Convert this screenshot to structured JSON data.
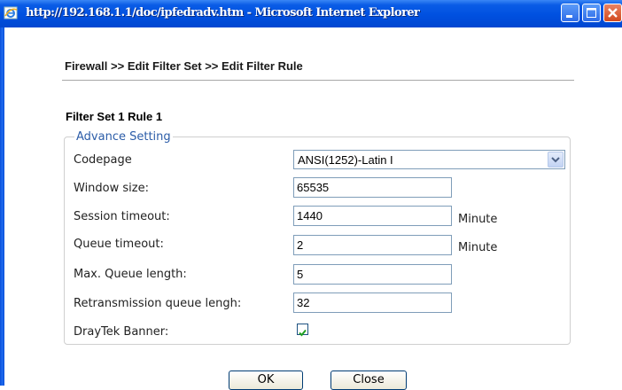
{
  "window": {
    "title": "http://192.168.1.1/doc/ipfedradv.htm - Microsoft Internet Explorer"
  },
  "page": {
    "breadcrumb": "Firewall >> Edit Filter Set >> Edit Filter Rule",
    "section_title": "Filter Set 1 Rule 1",
    "group_legend": "Advance Setting"
  },
  "form": {
    "codepage": {
      "label": "Codepage",
      "value": "ANSI(1252)-Latin I"
    },
    "window_size": {
      "label": "Window size:",
      "value": "65535"
    },
    "session_timeout": {
      "label": "Session timeout:",
      "value": "1440",
      "unit": "Minute"
    },
    "queue_timeout": {
      "label": "Queue timeout:",
      "value": "2",
      "unit": "Minute"
    },
    "max_queue_length": {
      "label": "Max. Queue length:",
      "value": "5"
    },
    "retransmission_queue_length": {
      "label": "Retransmission queue lengh:",
      "value": "32"
    },
    "draytek_banner": {
      "label": "DrayTek Banner:",
      "checked": true
    }
  },
  "buttons": {
    "ok": "OK",
    "close": "Close"
  }
}
